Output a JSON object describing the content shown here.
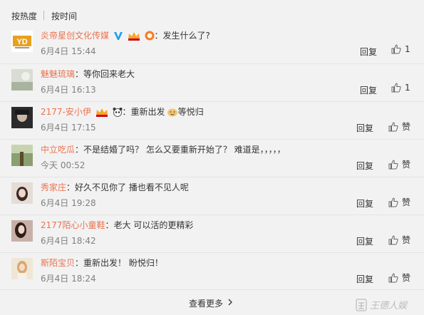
{
  "sort": {
    "hot_label": "按热度",
    "time_label": "按时间"
  },
  "reply_label": "回复",
  "like_label_default": "赞",
  "comments": [
    {
      "user": "炎帝星创文化传媒",
      "colon": "：",
      "text": "发生什么了?",
      "time": "6月4日 15:44",
      "like": "1"
    },
    {
      "user": "魅魅琉璃",
      "colon": "：",
      "text": "等你回来老大",
      "time": "6月4日 16:13",
      "like": "1"
    },
    {
      "user": "2177-安小伊",
      "colon": "：",
      "text": "重新出发",
      "text2": "等悦归",
      "time": "6月4日 17:15",
      "like": "赞"
    },
    {
      "user": "中立吃瓜",
      "colon": "：",
      "text": "不是结婚了吗？ 怎么又要重新开始了？ 难道是，，，，，",
      "time": "今天 00:52",
      "like": "赞"
    },
    {
      "user": "秀家庄",
      "colon": "：",
      "text": "好久不见你了 播也看不见人呢",
      "time": "6月4日 19:28",
      "like": "赞"
    },
    {
      "user": "2177陌心小童鞋",
      "colon": "：",
      "text": "老大 可以活的更精彩",
      "time": "6月4日 18:42",
      "like": "赞"
    },
    {
      "user": "斯陌宝贝",
      "colon": "：",
      "text": "重新出发！ 盼悦归！",
      "time": "6月4日 18:24",
      "like": "赞"
    }
  ],
  "more": {
    "label": "查看更多"
  },
  "watermark": {
    "text": "王德人娱"
  },
  "colors": {
    "username": "#eb7350",
    "time": "#808080",
    "background": "#f2f2f2",
    "vip_blue": "#1e9fe8"
  }
}
